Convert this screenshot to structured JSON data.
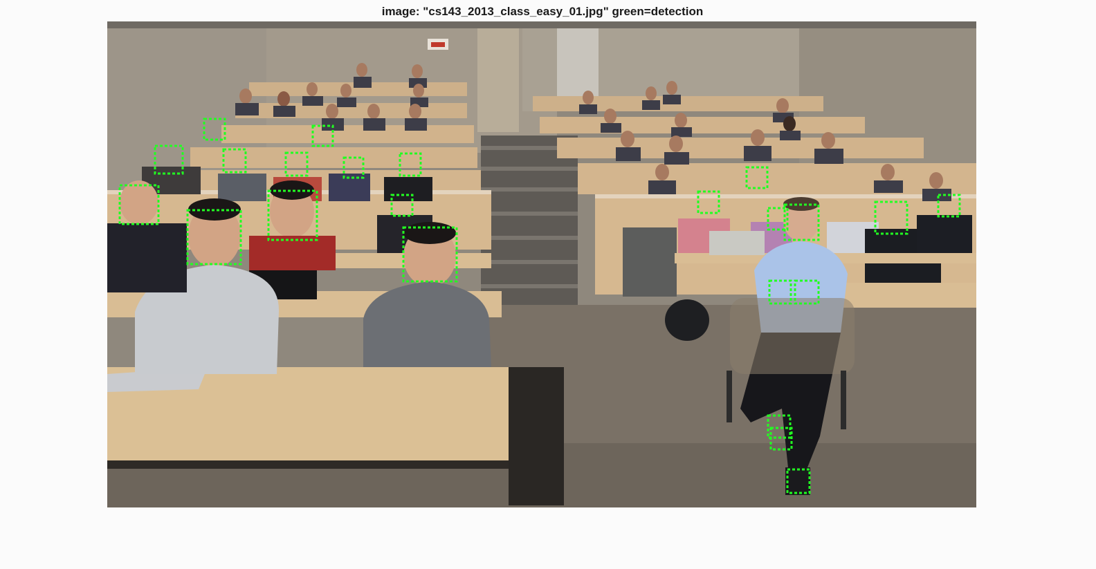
{
  "figure": {
    "title": "image: \"cs143_2013_class_easy_01.jpg\" green=detection"
  },
  "image": {
    "scene": "lecture-hall-classroom",
    "detection_color": "#22ff22"
  },
  "detections": {
    "count": 31
  }
}
